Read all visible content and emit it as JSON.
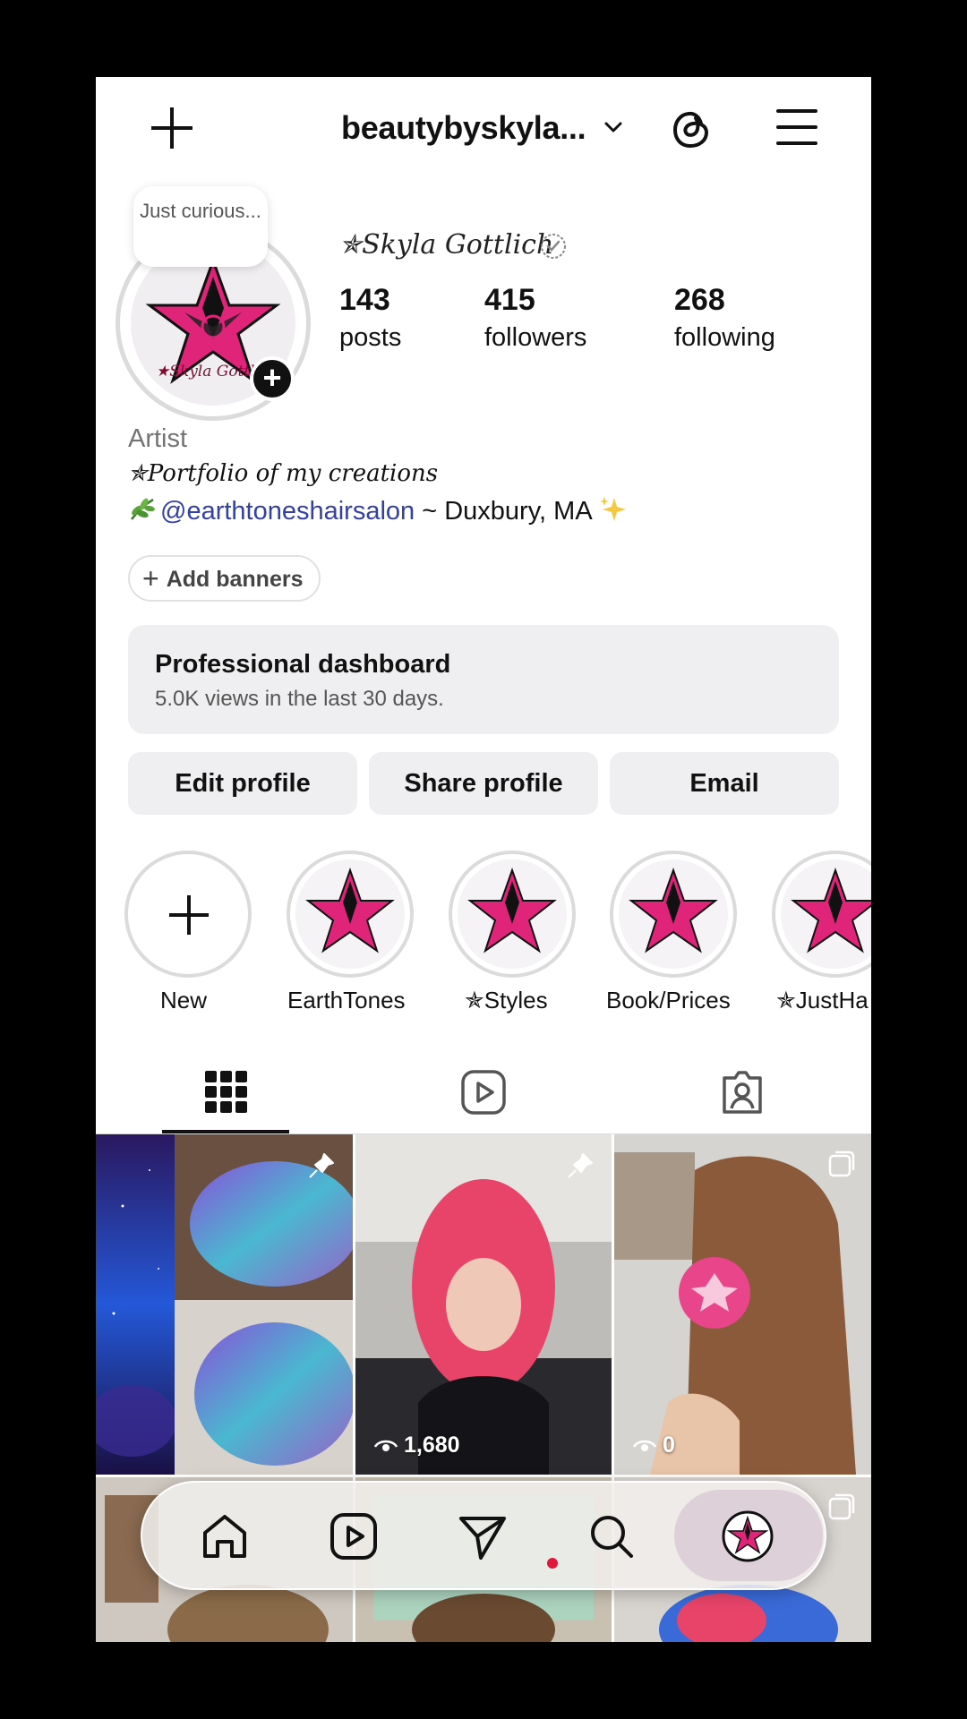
{
  "header": {
    "username": "beautybyskyla...",
    "icons": [
      "plus-icon",
      "chevron-down-icon",
      "threads-icon",
      "menu-icon"
    ]
  },
  "profile": {
    "note": "Just curious...",
    "display_name": "✯Skyla Gottlich",
    "avatar_text": "★Skyla Gottl",
    "stats": [
      {
        "num": "143",
        "label": "posts"
      },
      {
        "num": "415",
        "label": "followers"
      },
      {
        "num": "268",
        "label": "following"
      }
    ],
    "category": "Artist",
    "bio_line1": "✯Portfolio of my creations",
    "bio_link": "@earthtoneshairsalon",
    "bio_rest": " ~ Duxbury, MA"
  },
  "add_banners": "Add banners",
  "dashboard": {
    "title": "Professional dashboard",
    "subtitle": "5.0K views in the last 30 days."
  },
  "buttons": {
    "edit": "Edit profile",
    "share": "Share profile",
    "email": "Email"
  },
  "highlights": [
    {
      "label": "New"
    },
    {
      "label": "EarthTones"
    },
    {
      "label": "✯Styles"
    },
    {
      "label": "Book/Prices"
    },
    {
      "label": "✯JustHa"
    }
  ],
  "grid": {
    "views": [
      "1,680",
      "0"
    ]
  },
  "colors": {
    "accent_link": "#3340a4",
    "star_pink": "#e0247a",
    "notification_dot": "#e0163a"
  }
}
